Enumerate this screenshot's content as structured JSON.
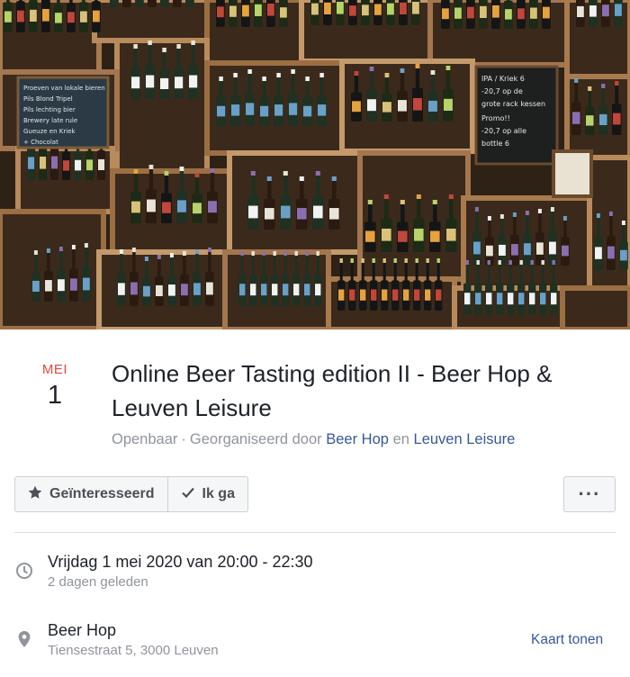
{
  "cover": {
    "board_left_lines": [
      "Proeven van lokale bieren",
      "Pils  Blond  Tripel",
      "Pils lechting bier",
      "Brewery late rule",
      "Gueuze en Kriek",
      "+ Chocolat"
    ],
    "board_right_lines": [
      "IPA / Kriek 6",
      "-20,7 op de",
      "grote rack kessen",
      "Promo!!",
      "-20,7 op alle",
      "bottle 6"
    ]
  },
  "event": {
    "month": "MEI",
    "day": "1",
    "title": "Online Beer Tasting edition II - Beer Hop & Leuven Leisure",
    "privacy": "Openbaar",
    "separator": "·",
    "organized_by": "Georganiseerd door",
    "organizer_1": "Beer Hop",
    "and": "en",
    "organizer_2": "Leuven Leisure"
  },
  "actions": {
    "interested_label": "Geïnteresseerd",
    "going_label": "Ik ga",
    "more_label": "···"
  },
  "info": {
    "datetime": "Vrijdag 1 mei 2020 van 20:00 - 22:30",
    "relative": "2 dagen geleden",
    "location_name": "Beer Hop",
    "location_address": "Tiensestraat 5, 3000 Leuven",
    "map_link": "Kaart tonen"
  },
  "icons": {
    "interested": "star-icon",
    "going": "checkmark-icon",
    "time": "clock-icon",
    "location": "map-pin-icon"
  },
  "colors": {
    "date_month": "#e4463c",
    "link": "#365899",
    "muted": "#90949c",
    "text": "#1d2129"
  }
}
